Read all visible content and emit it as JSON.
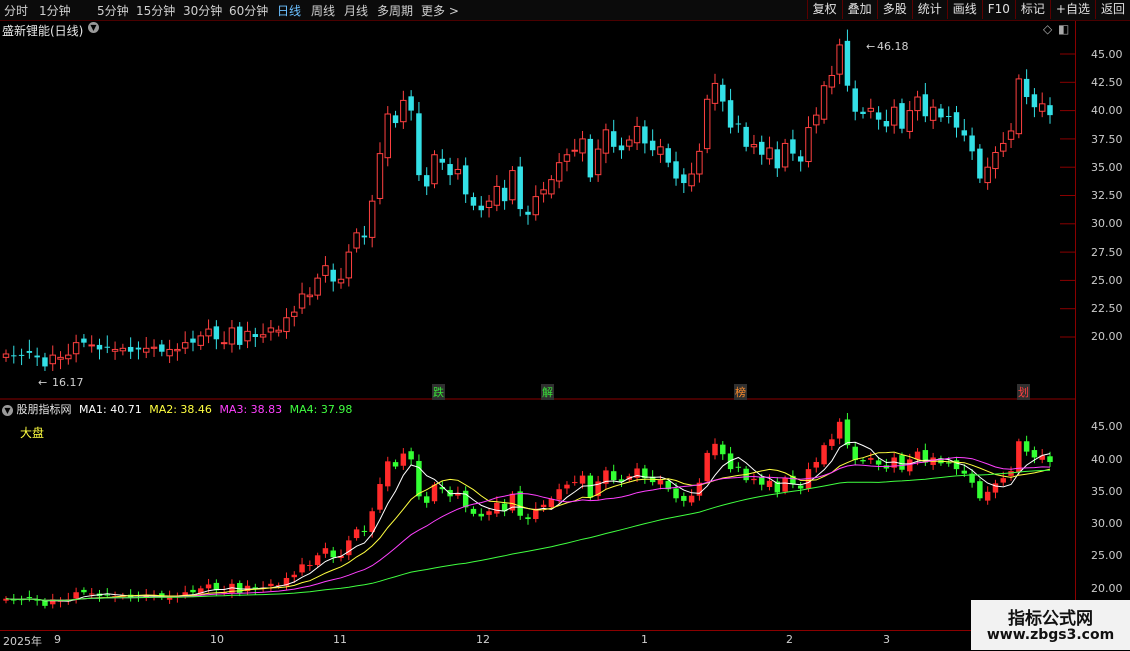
{
  "toolbar": {
    "periods": [
      "分时",
      "1分钟",
      "5分钟",
      "15分钟",
      "30分钟",
      "60分钟",
      "日线",
      "周线",
      "月线",
      "多周期",
      "更多 >"
    ],
    "active_period": "日线",
    "buttons": [
      "复权",
      "叠加",
      "多股",
      "统计",
      "画线",
      "F10",
      "标记",
      "+自选",
      "返回"
    ]
  },
  "main": {
    "title": "盛新锂能(日线)",
    "high_label": "46.18",
    "low_label": "16.17",
    "yticks": [
      "45.00",
      "42.50",
      "40.00",
      "37.50",
      "35.00",
      "32.50",
      "30.00",
      "27.50",
      "25.00",
      "22.50",
      "20.00"
    ],
    "signals": [
      {
        "text": "跌",
        "color": "#37e137"
      },
      {
        "text": "解",
        "color": "#37e137"
      },
      {
        "text": "榜",
        "color": "#ff8c2a"
      },
      {
        "text": "划",
        "color": "#ff4040"
      }
    ]
  },
  "indicator": {
    "name": "股朋指标网",
    "ma1": "MA1: 40.71",
    "ma2": "MA2: 38.46",
    "ma3": "MA3: 38.83",
    "ma4": "MA4: 37.98",
    "label": "大盘",
    "yticks": [
      "45.00",
      "40.00",
      "35.00",
      "30.00",
      "25.00",
      "20.00"
    ],
    "colors": {
      "ma1": "#ffffff",
      "ma2": "#ffff40",
      "ma3": "#ff40ff",
      "ma4": "#40ff40"
    }
  },
  "xaxis": {
    "labels": [
      "2025年",
      "9",
      "10",
      "11",
      "12",
      "1",
      "2",
      "3"
    ]
  },
  "watermark": {
    "title": "指标公式网",
    "url": "www.zbgs3.com"
  },
  "chart_data": {
    "type": "candlestick",
    "series_close": [
      18.5,
      18.3,
      18.4,
      18.6,
      18.2,
      17.4,
      18.4,
      18.2,
      18.4,
      19.5,
      19.5,
      19.3,
      18.9,
      19.1,
      18.9,
      19.0,
      18.7,
      18.9,
      19.0,
      19.1,
      18.7,
      18.9,
      18.9,
      19.5,
      19.5,
      20.1,
      20.7,
      19.8,
      19.5,
      20.8,
      19.3,
      20.5,
      20.0,
      20.2,
      20.8,
      20.6,
      21.7,
      22.2,
      23.8,
      23.7,
      25.2,
      26.3,
      24.9,
      25.1,
      27.5,
      29.2,
      28.8,
      32.0,
      36.2,
      39.7,
      38.9,
      40.9,
      40.0,
      34.3,
      33.3,
      36.1,
      35.4,
      34.3,
      34.8,
      32.6,
      31.6,
      31.2,
      32.0,
      33.3,
      32.0,
      34.7,
      31.3,
      30.8,
      32.4,
      33.0,
      33.9,
      35.4,
      36.1,
      36.5,
      37.5,
      34.1,
      36.6,
      38.3,
      36.8,
      36.5,
      37.4,
      38.6,
      37.1,
      36.5,
      36.8,
      35.4,
      34.0,
      33.6,
      34.4,
      36.4,
      41.0,
      42.4,
      40.8,
      38.5,
      38.8,
      36.8,
      37.0,
      36.1,
      36.7,
      34.9,
      37.1,
      36.2,
      35.5,
      38.5,
      39.6,
      42.2,
      43.1,
      45.8,
      42.2,
      39.9,
      39.7,
      40.2,
      39.2,
      38.6,
      40.3,
      38.4,
      40.0,
      41.2,
      39.5,
      40.3,
      39.4,
      39.5,
      38.5,
      37.8,
      36.4,
      34.0,
      35.0,
      36.3,
      37.1,
      38.2,
      42.8,
      41.2,
      40.3,
      40.6,
      39.6
    ]
  }
}
